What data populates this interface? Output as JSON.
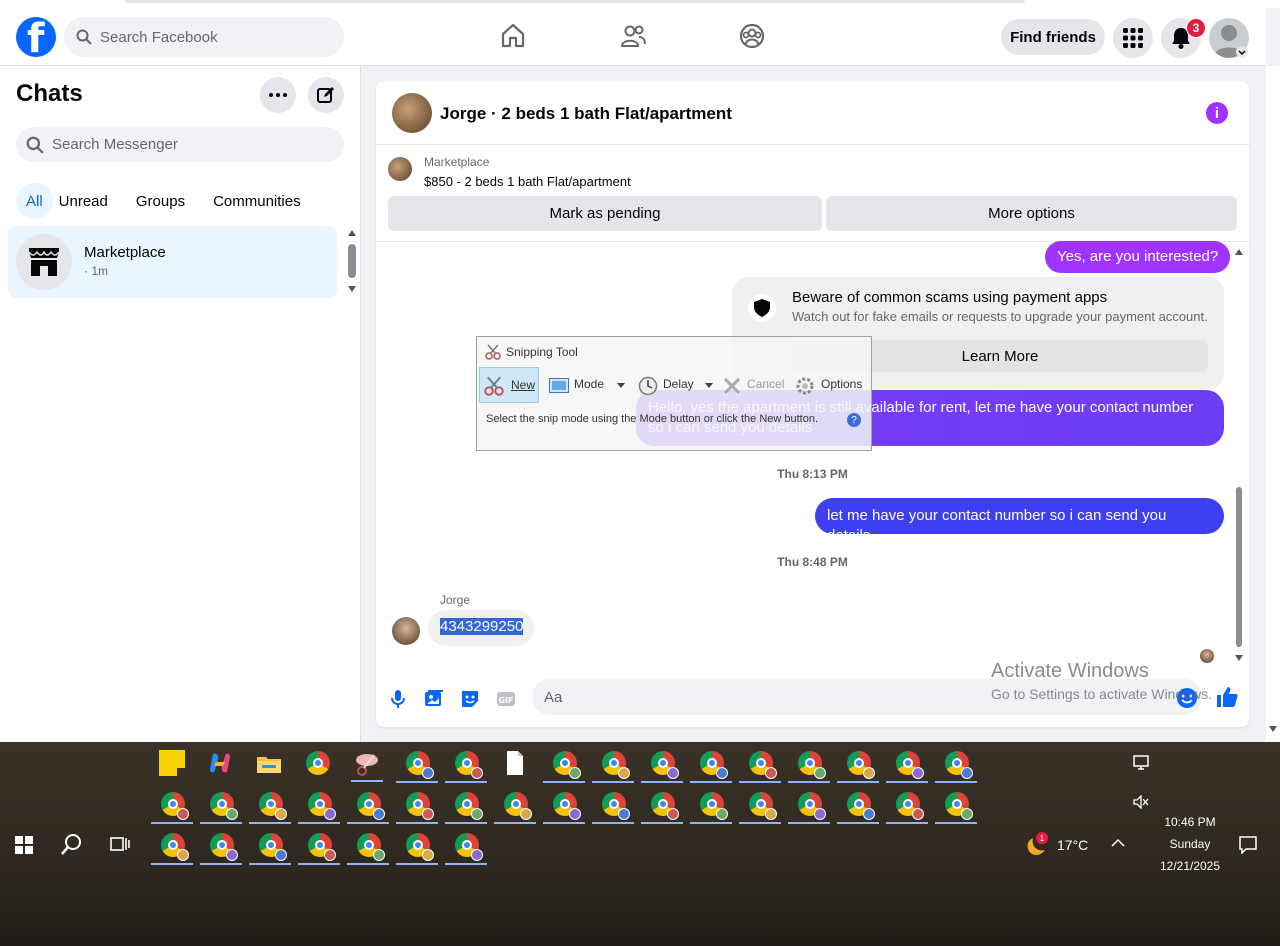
{
  "topbar": {
    "search_placeholder": "Search Facebook",
    "find_friends": "Find friends",
    "notif_count": "3"
  },
  "sidebar": {
    "title": "Chats",
    "search_placeholder": "Search Messenger",
    "filters": [
      "All",
      "Unread",
      "Groups",
      "Communities"
    ],
    "chat": {
      "name": "Marketplace",
      "time": "· 1m"
    }
  },
  "conversation": {
    "title": "Jorge · 2 beds 1 bath Flat/apartment",
    "marketplace_label": "Marketplace",
    "listing": "$850 - 2 beds 1 bath Flat/apartment",
    "mark_pending": "Mark as pending",
    "more_options": "More options",
    "messages": {
      "m1": "Yes, are you interested?",
      "scam_title": "Beware of common scams using payment apps",
      "scam_sub": "Watch out for fake emails or requests to upgrade your payment account.",
      "learn_more": "Learn More",
      "m2": "Hello, yes the apartment is still available for rent, let me have your contact number so i can send you details",
      "t1": "Thu 8:13 PM",
      "m3": "let me have your contact number so i can send you details",
      "t2": "Thu 8:48 PM",
      "sender": "Jorge",
      "m4": "4343299250"
    },
    "composer_placeholder": "Aa"
  },
  "snipping_tool": {
    "title": "Snipping Tool",
    "new": "New",
    "mode": "Mode",
    "delay": "Delay",
    "cancel": "Cancel",
    "options": "Options",
    "help": "Select the snip mode using the Mode button or click the New button.",
    "help_q": "?"
  },
  "watermark": {
    "line1": "Activate Windows",
    "line2": "Go to Settings to activate Windows."
  },
  "taskbar": {
    "weather_temp": "17°C",
    "weather_badge": "1",
    "time": "10:46 PM",
    "day": "Sunday",
    "date": "12/21/2025"
  },
  "colors": {
    "brand": "#0866ff",
    "purple_bubble": "#a033ff",
    "blue_bubble": "#3d3ff0"
  }
}
